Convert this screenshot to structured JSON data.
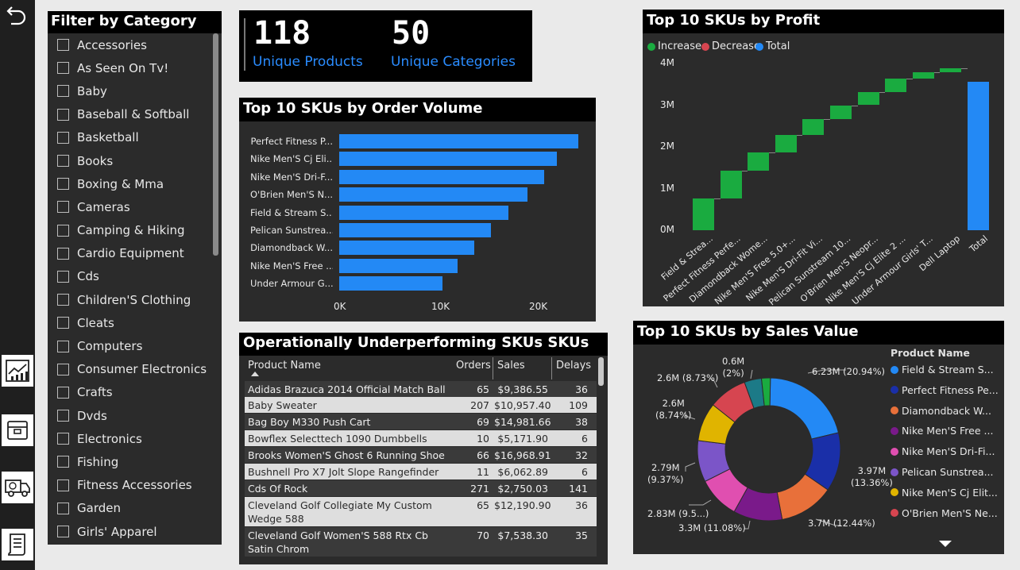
{
  "filter": {
    "title": "Filter by Category",
    "items": [
      "Accessories",
      "As Seen On Tv!",
      "Baby",
      "Baseball & Softball",
      "Basketball",
      "Books",
      "Boxing & Mma",
      "Cameras",
      "Camping & Hiking",
      "Cardio Equipment",
      "Cds",
      "Children'S Clothing",
      "Cleats",
      "Computers",
      "Consumer Electronics",
      "Crafts",
      "Dvds",
      "Electronics",
      "Fishing",
      "Fitness Accessories",
      "Garden",
      "Girls' Apparel"
    ]
  },
  "kpi": {
    "products_value": "118",
    "products_label": "Unique Products",
    "categories_value": "50",
    "categories_label": "Unique Categories"
  },
  "order_volume": {
    "title": "Top 10 SKUs by Order Volume",
    "categories": [
      "Perfect Fitness P...",
      "Nike Men'S Cj Eli...",
      "Nike Men'S Dri-F...",
      "O'Brien Men'S N...",
      "Field & Stream S...",
      "Pelican Sunstrea...",
      "Diamondback W...",
      "Nike Men'S Free ...",
      "Under Armour G..."
    ],
    "values": [
      24500,
      22300,
      21000,
      19300,
      17300,
      15500,
      13800,
      12100,
      10600
    ],
    "ticks": [
      "0K",
      "10K",
      "20K"
    ]
  },
  "table": {
    "title": "Operationally Underperforming SKUs SKUs",
    "columns": [
      "Product Name",
      "Orders",
      "Sales",
      "Delays"
    ],
    "rows": [
      {
        "name": "Adidas Brazuca 2014 Official Match Ball",
        "orders": "65",
        "sales": "$9,386.55",
        "delays": "36"
      },
      {
        "name": "Baby Sweater",
        "orders": "207",
        "sales": "$10,957.40",
        "delays": "109"
      },
      {
        "name": "Bag Boy M330 Push Cart",
        "orders": "69",
        "sales": "$14,981.66",
        "delays": "38"
      },
      {
        "name": "Bowflex Selecttech 1090 Dumbbells",
        "orders": "10",
        "sales": "$5,171.90",
        "delays": "6"
      },
      {
        "name": "Brooks Women'S Ghost 6 Running Shoe",
        "orders": "66",
        "sales": "$16,968.91",
        "delays": "32"
      },
      {
        "name": "Bushnell Pro X7 Jolt Slope Rangefinder",
        "orders": "11",
        "sales": "$6,062.89",
        "delays": "6"
      },
      {
        "name": "Cds Of Rock",
        "orders": "271",
        "sales": "$2,750.03",
        "delays": "141"
      },
      {
        "name": "Cleveland Golf Collegiate My Custom Wedge 588",
        "orders": "65",
        "sales": "$12,190.90",
        "delays": "36"
      },
      {
        "name": "Cleveland Golf Women'S 588 Rtx Cb Satin Chrom",
        "orders": "70",
        "sales": "$7,538.30",
        "delays": "35"
      }
    ]
  },
  "profit": {
    "title": "Top 10 SKUs by Profit",
    "legend": [
      {
        "label": "Increase",
        "color": "#1aab40"
      },
      {
        "label": "Decrease",
        "color": "#d64550"
      },
      {
        "label": "Total",
        "color": "#2389f5"
      }
    ],
    "yticks": [
      "4M",
      "3M",
      "2M",
      "1M",
      "0M"
    ],
    "ylim": [
      0,
      4
    ],
    "categories": [
      "Field & Strea...",
      "Perfect Fitness Perfe...",
      "Diamondback Wome...",
      "Nike Men'S Free 5.0+...",
      "Nike Men'S Dri-Fit Vi...",
      "Pelican Sunstream 10...",
      "O'Brien Men'S Neopr...",
      "Nike Men'S Cj Elite 2 ...",
      "Under Armour Girls' T...",
      "Dell Laptop",
      "Total"
    ],
    "values": [
      0.77,
      0.65,
      0.44,
      0.43,
      0.37,
      0.34,
      0.32,
      0.32,
      0.15,
      0.1,
      3.56
    ]
  },
  "sales": {
    "title": "Top 10 SKUs by Sales Value",
    "legend_title": "Product Name",
    "legend": [
      {
        "label": "Field & Stream S...",
        "color": "#2389f5"
      },
      {
        "label": "Perfect Fitness Pe...",
        "color": "#1a2fa8"
      },
      {
        "label": "Diamondback W...",
        "color": "#e8703a"
      },
      {
        "label": "Nike Men'S Free ...",
        "color": "#7a1a8a"
      },
      {
        "label": "Nike Men'S Dri-Fi...",
        "color": "#e04fb0"
      },
      {
        "label": "Pelican Sunstrea...",
        "color": "#7b55c8"
      },
      {
        "label": "Nike Men'S Cj Elit...",
        "color": "#e0b400"
      },
      {
        "label": "O'Brien Men'S Ne...",
        "color": "#d64550"
      }
    ],
    "extra_colors": [
      "#1c7a87",
      "#1aab40"
    ],
    "slices": [
      20.94,
      13.36,
      12.44,
      11.08,
      9.5,
      9.37,
      8.74,
      8.73,
      3.9,
      2.0
    ],
    "labels": [
      {
        "line1": "6.23M (20.94%)",
        "line2": ""
      },
      {
        "line1": "3.97M",
        "line2": "(13.36%)"
      },
      {
        "line1": "3.7M (12.44%)",
        "line2": ""
      },
      {
        "line1": "3.3M (11.08%)",
        "line2": ""
      },
      {
        "line1": "2.83M (9.5...)",
        "line2": ""
      },
      {
        "line1": "2.79M",
        "line2": "(9.37%)"
      },
      {
        "line1": "2.6M",
        "line2": "(8.74%)"
      },
      {
        "line1": "2.6M (8.73%)",
        "line2": ""
      },
      {
        "line1": "0.6M",
        "line2": "(2%)"
      }
    ]
  },
  "nav": {
    "back_icon": "back-arrow-icon",
    "pages": [
      "dashboard-chart-icon",
      "inventory-box-icon",
      "delivery-truck-icon",
      "report-document-icon"
    ]
  }
}
